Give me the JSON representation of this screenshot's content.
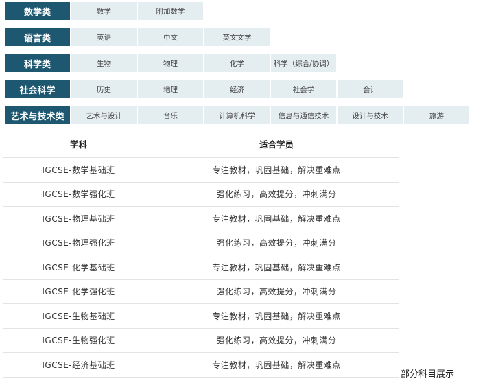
{
  "categories": [
    {
      "label": "数学类",
      "items": [
        "数学",
        "附加数学"
      ]
    },
    {
      "label": "语言类",
      "items": [
        "英语",
        "中文",
        "英文文学"
      ]
    },
    {
      "label": "科学类",
      "items": [
        "生物",
        "物理",
        "化学",
        "科学（综合/协调）"
      ]
    },
    {
      "label": "社会科学",
      "items": [
        "历史",
        "地理",
        "经济",
        "社会学",
        "会计"
      ]
    },
    {
      "label": "艺术与技术类",
      "items": [
        "艺术与设计",
        "音乐",
        "计算机科学",
        "信息与通信技术",
        "设计与技术",
        "旅游"
      ]
    }
  ],
  "table": {
    "headers": [
      "学科",
      "适合学员"
    ],
    "rows": [
      [
        "IGCSE-数学基础班",
        "专注教材，巩固基础，解决重难点"
      ],
      [
        "IGCSE-数学强化班",
        "强化练习，高效提分，冲刺满分"
      ],
      [
        "IGCSE-物理基础班",
        "专注教材，巩固基础，解决重难点"
      ],
      [
        "IGCSE-物理强化班",
        "强化练习，高效提分，冲刺满分"
      ],
      [
        "IGCSE-化学基础班",
        "专注教材，巩固基础，解决重难点"
      ],
      [
        "IGCSE-化学强化班",
        "强化练习，高效提分，冲刺满分"
      ],
      [
        "IGCSE-生物基础班",
        "专注教材，巩固基础，解决重难点"
      ],
      [
        "IGCSE-生物强化班",
        "强化练习，高效提分，冲刺满分"
      ],
      [
        "IGCSE-经济基础班",
        "专注教材，巩固基础，解决重难点"
      ]
    ]
  },
  "caption": "部分科目展示",
  "colors": {
    "label_bg": "#1d5870",
    "item_bg": "#e4edf0"
  }
}
